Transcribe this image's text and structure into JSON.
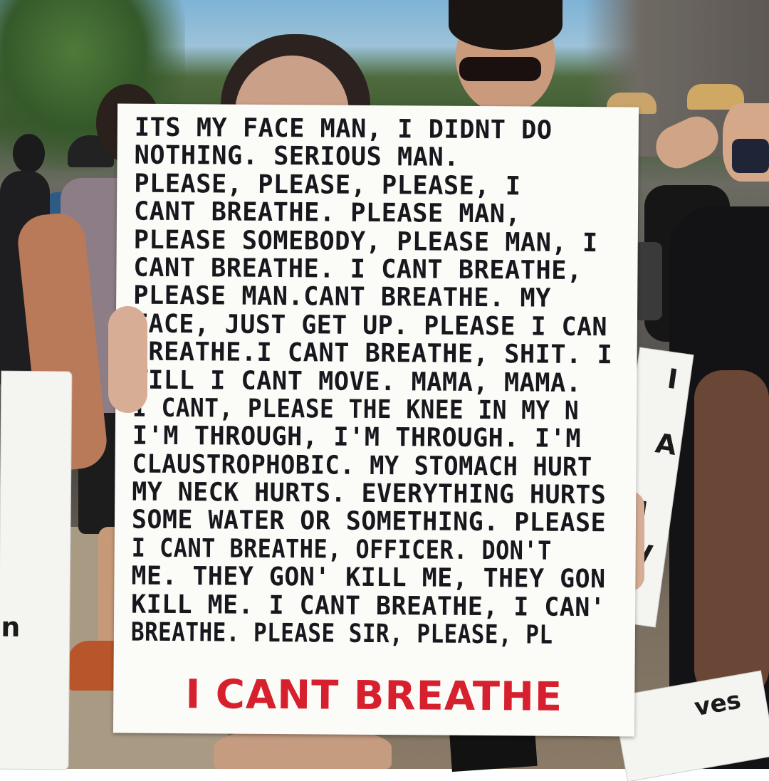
{
  "photo": {
    "subject": "Protest sign",
    "sign": {
      "lines": [
        "ITS MY FACE MAN, I DIDNT DO",
        "NOTHING. SERIOUS MAN.",
        "PLEASE, PLEASE, PLEASE, I",
        "CANT BREATHE. PLEASE MAN,",
        "PLEASE SOMEBODY, PLEASE MAN, I",
        "CANT BREATHE. I CANT BREATHE,",
        "PLEASE MAN.CANT BREATHE. MY",
        "FACE, JUST GET UP. PLEASE I CANT",
        "BREATHE.I CANT BREATHE, SHIT. I",
        "WILL I CANT MOVE. MAMA, MAMA.",
        "I CANT, PLEASE THE KNEE IN MY NECK",
        "I'M THROUGH, I'M THROUGH. I'M",
        "CLAUSTROPHOBIC. MY STOMACH HURTS,",
        "MY NECK HURTS. EVERYTHING HURTS.",
        "SOME WATER OR SOMETHING. PLEASE.",
        "I CANT BREATHE, OFFICER. DON'T KILL",
        "ME. THEY GON' KILL ME, THEY GON'",
        "KILL ME. I CANT BREATHE, I CAN'T",
        "BREATHE. PLEASE SIR, PLEASE, PLEASE."
      ],
      "headline": "I CANT BREATHE",
      "text_color": "#17181d",
      "headline_color": "#d7202e",
      "background_color": "#fbfbf8"
    },
    "background_signs": {
      "right_fragments": [
        "I",
        "A",
        "J",
        "EV",
        "#"
      ],
      "left_fragment": "n",
      "bottom_right_fragment": "ves"
    }
  }
}
